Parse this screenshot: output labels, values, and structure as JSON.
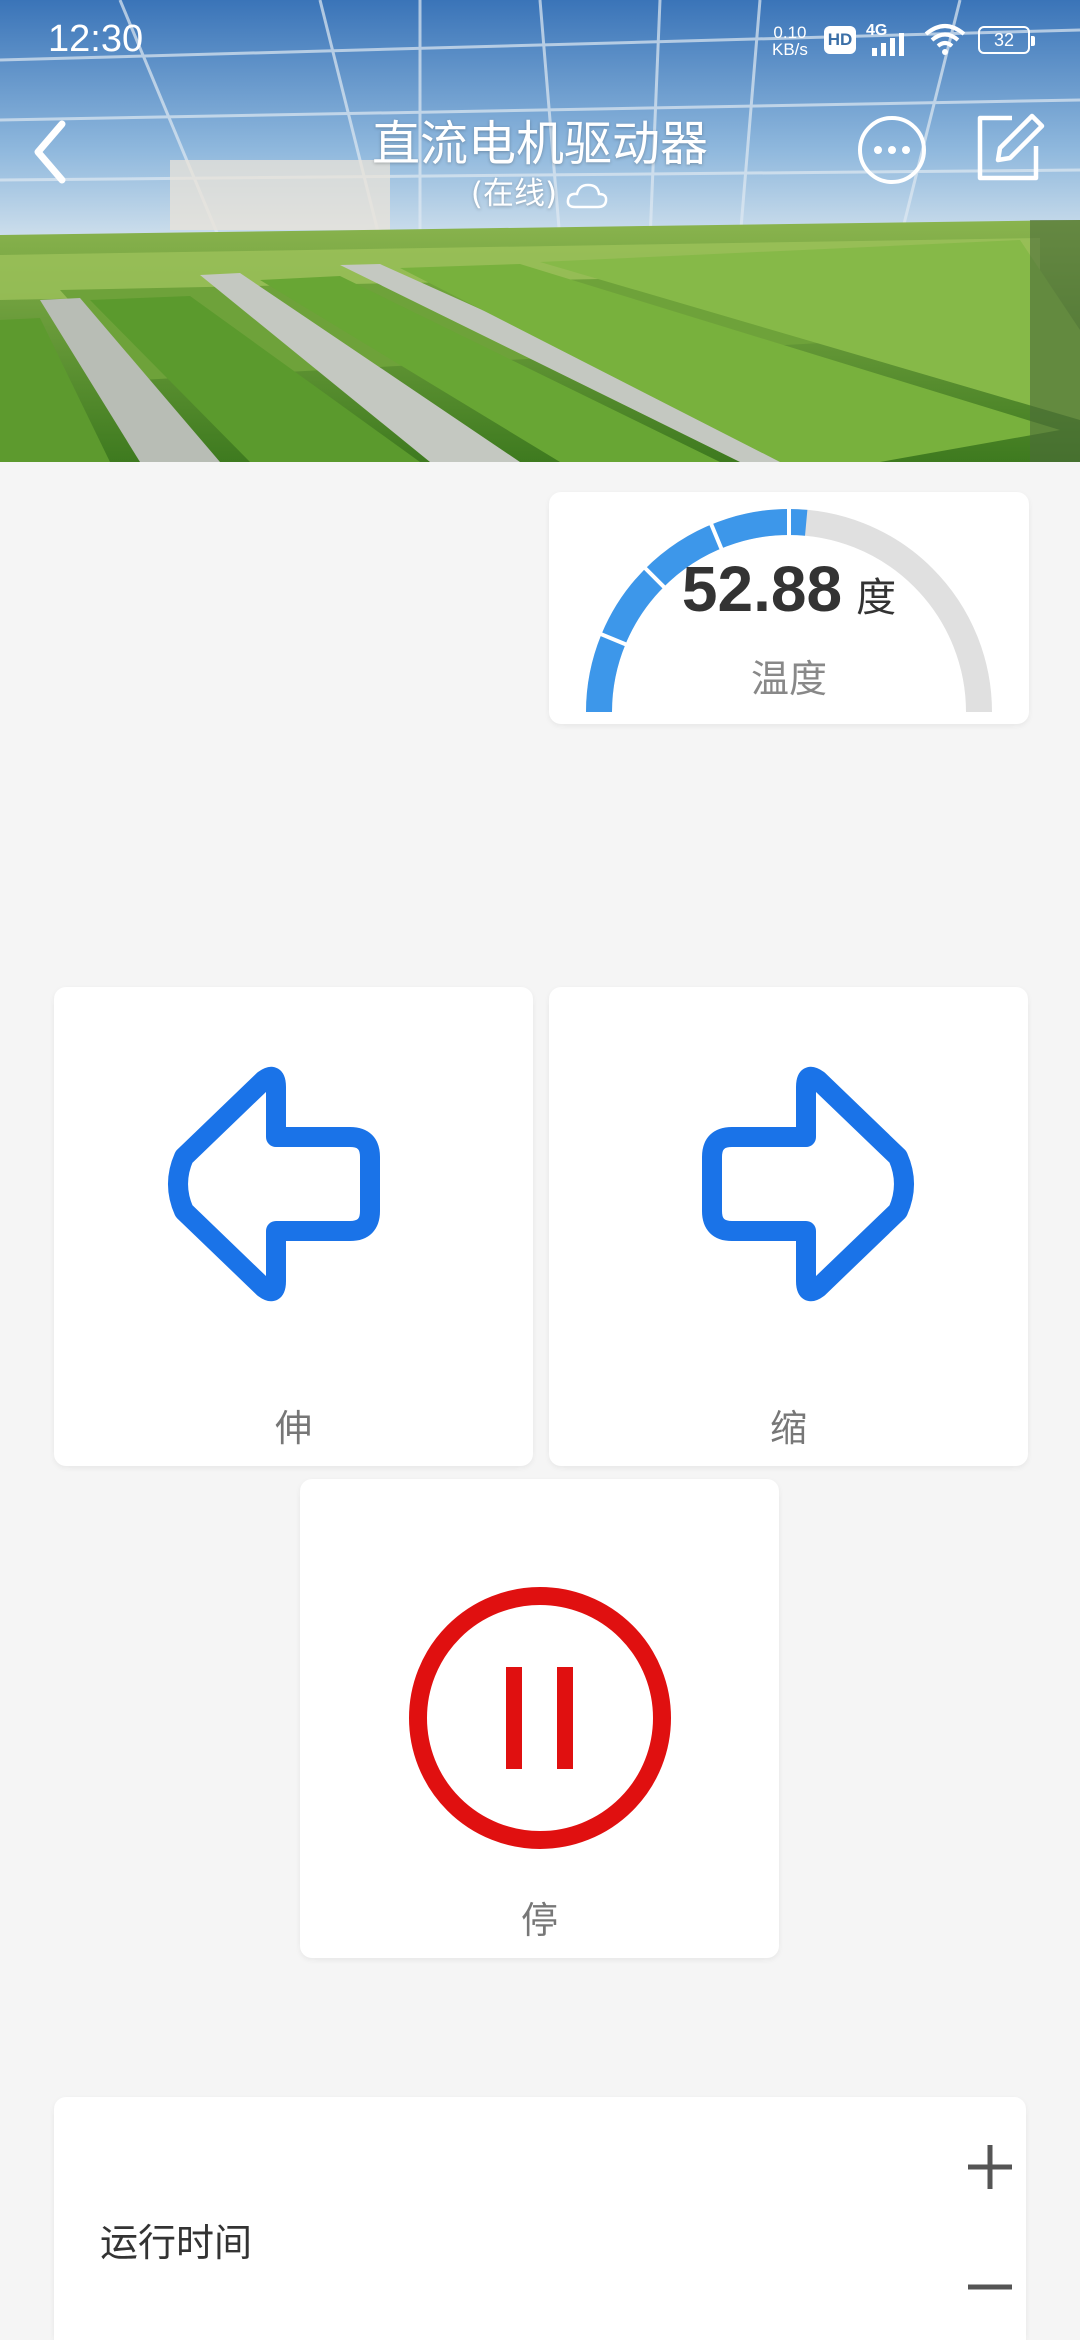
{
  "status_bar": {
    "time": "12:30",
    "net_speed_value": "0.10",
    "net_speed_unit": "KB/s",
    "hd_label": "HD",
    "network_type": "4G",
    "battery_level": "32"
  },
  "header": {
    "title": "直流电机驱动器",
    "status": "(在线)"
  },
  "gauge": {
    "value": "52.88",
    "unit": "度",
    "label": "温度",
    "fill_fraction": 0.5288,
    "track_color": "#e0e0e0",
    "fill_color": "#3d97ea"
  },
  "controls": {
    "extend_label": "伸",
    "retract_label": "缩",
    "stop_label": "停",
    "arrow_color": "#1a73e8",
    "stop_color": "#e01010"
  },
  "runtime": {
    "label": "运行时间"
  }
}
